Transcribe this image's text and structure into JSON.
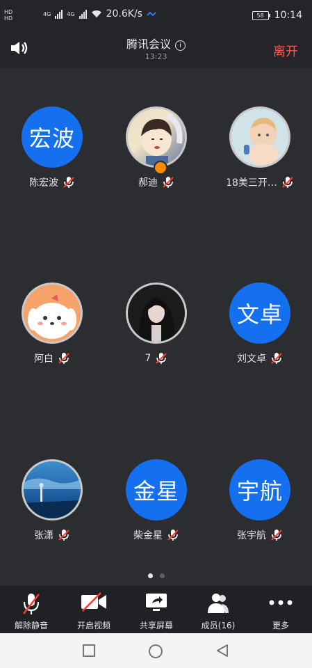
{
  "status_bar": {
    "hd_top": "HD",
    "hd_bottom": "HD",
    "network_1": "4G",
    "network_2": "4G",
    "speed": "20.6K/s",
    "battery": "58",
    "time": "10:14"
  },
  "header": {
    "title": "腾讯会议",
    "timer": "13:23",
    "leave_label": "离开",
    "leave_color": "#ff5a4f"
  },
  "participants": [
    {
      "name": "陈宏波",
      "avatar_text": "宏波",
      "avatar_type": "text"
    },
    {
      "name": "郝迪",
      "avatar_type": "image",
      "host": true
    },
    {
      "name": "18美三开…",
      "avatar_type": "image"
    },
    {
      "name": "阿白",
      "avatar_type": "image"
    },
    {
      "name": "7",
      "avatar_type": "image"
    },
    {
      "name": "刘文卓",
      "avatar_text": "文卓",
      "avatar_type": "text"
    },
    {
      "name": "张潇",
      "avatar_type": "image"
    },
    {
      "name": "柴金星",
      "avatar_text": "金星",
      "avatar_type": "text"
    },
    {
      "name": "张宇航",
      "avatar_text": "宇航",
      "avatar_type": "text"
    }
  ],
  "pager": {
    "pages": 2,
    "current": 1
  },
  "toolbar": {
    "unmute": "解除静音",
    "start_video": "开启视频",
    "share_screen": "共享屏幕",
    "members": "成员(16)",
    "more": "更多"
  },
  "colors": {
    "avatar_blue": "#1570f0",
    "background": "#2b2d30",
    "mic_off_red": "#ff3b30"
  }
}
